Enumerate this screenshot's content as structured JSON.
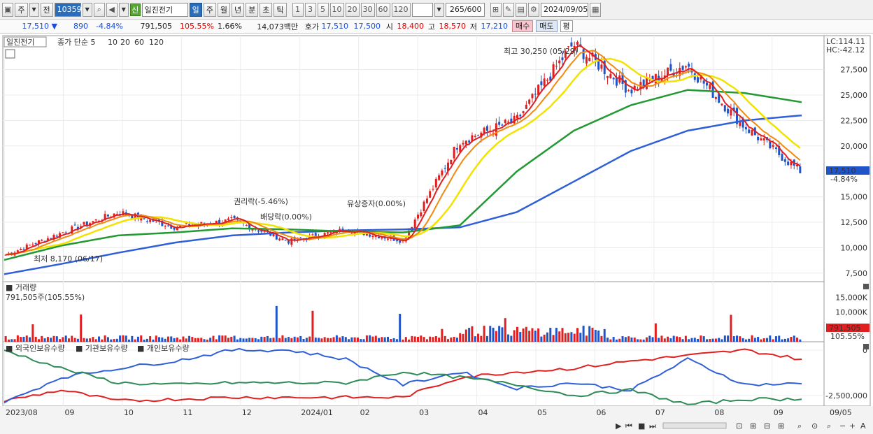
{
  "toolbar": {
    "period_label": "주",
    "prev_label": "전",
    "stock_code": "103590",
    "sin_label": "신",
    "stock_name": "일진전기",
    "tabs": [
      "일",
      "주",
      "월",
      "년",
      "분",
      "초",
      "틱"
    ],
    "active_tab": "일",
    "intervals": [
      "1",
      "3",
      "5",
      "10",
      "20",
      "30",
      "60",
      "120"
    ],
    "count": "265/600",
    "date": "2024/09/05"
  },
  "quote": {
    "price": "17,510",
    "change": "890",
    "change_pct": "-4.84%",
    "volume": "791,505",
    "vol_ratio": "105.55%",
    "turnover_pct": "1.66%",
    "amount": "14,073백만",
    "hoga_label": "호가",
    "ask": "17,510",
    "bid": "17,500",
    "open_label": "시",
    "open": "18,400",
    "high_label": "고",
    "high": "18,570",
    "low_label": "저",
    "low": "17,210",
    "buy_label": "매수",
    "sell_label": "매도",
    "avg_label": "평"
  },
  "colors": {
    "up": "#e02020",
    "down": "#1f55c8",
    "ma5": "#e02020",
    "ma10": "#f08a10",
    "ma20": "#f2e200",
    "ma60": "#229933",
    "ma120": "#2f5fd8",
    "foreign": "#e02020",
    "institution": "#3060d8",
    "individual": "#2e8b57"
  },
  "chart_data": [
    {
      "type": "candlestick",
      "title": "일진전기",
      "legend": [
        "종가 단순 5",
        "10",
        "20",
        "60",
        "120"
      ],
      "price_label": "17,510",
      "price_change": "-4.84%",
      "lc_label": "LC:114.11",
      "hc_label": "HC:-42.12",
      "yticks": [
        "27,500",
        "25,000",
        "22,500",
        "20,000",
        "15,000",
        "12,500",
        "10,000",
        "7,500"
      ],
      "ylim": [
        6800,
        30700
      ],
      "xticks": [
        "2023/08",
        "09",
        "10",
        "11",
        "12",
        "2024/01",
        "02",
        "03",
        "04",
        "05",
        "06",
        "07",
        "08",
        "09",
        "09/05"
      ],
      "annotations": [
        {
          "text": "최고 30,250 (05/29)"
        },
        {
          "text": "최저 8,170 (06/17)"
        },
        {
          "text": "권리락(-5.46%)"
        },
        {
          "text": "배당락(0.00%)"
        },
        {
          "text": "유상증자(0.00%)"
        }
      ],
      "ma_points": {
        "x_months": [
          "2023/08",
          "09",
          "10",
          "11",
          "12",
          "2024/01",
          "02",
          "03",
          "04",
          "05",
          "06",
          "07",
          "08",
          "09"
        ],
        "close": [
          9300,
          11500,
          13500,
          12000,
          12700,
          10600,
          11800,
          10700,
          20500,
          22500,
          30000,
          25500,
          28000,
          22000,
          17510
        ],
        "ma60": [
          8800,
          10200,
          11200,
          11500,
          11900,
          11800,
          11600,
          11500,
          12200,
          17500,
          21500,
          24000,
          25500,
          25200,
          24300
        ],
        "ma120": [
          7400,
          8400,
          9500,
          10500,
          11200,
          11500,
          11700,
          11800,
          12000,
          13500,
          16500,
          19500,
          21500,
          22500,
          23000
        ]
      }
    },
    {
      "type": "bar",
      "title": "거래량",
      "value_label": "791,505주(105.55%)",
      "yticks": [
        "15,000K",
        "10,000K",
        "5,000K"
      ],
      "last_label": "791,505",
      "last_ratio": "105.55%",
      "max_value": 16500000
    },
    {
      "type": "line",
      "legend": [
        "외국인보유수량",
        "기관보유수량",
        "개인보유수량"
      ],
      "yticks": [
        "0",
        "-2,500,000"
      ],
      "series": [
        {
          "name": "외국인보유수량",
          "values": [
            -2800000,
            -2200000,
            -2800000,
            -2700000,
            -2600000,
            -2600000,
            -2600000,
            -2600000,
            -1500000,
            -1200000,
            -1000000,
            -600000,
            -300000,
            0,
            -500000
          ]
        },
        {
          "name": "기관보유수량",
          "values": [
            -2900000,
            -1500000,
            -1000000,
            -600000,
            0,
            0,
            -500000,
            -1900000,
            -1200000,
            -2100000,
            -1800000,
            -2200000,
            -500000,
            -1900000,
            -1850000
          ]
        },
        {
          "name": "개인보유수량",
          "values": [
            0,
            -1000000,
            -1800000,
            -1900000,
            -1800000,
            -1800000,
            -1800000,
            -1200000,
            -1500000,
            -1900000,
            -2500000,
            -2200000,
            -3000000,
            -2700000,
            -2700000
          ]
        }
      ]
    }
  ]
}
